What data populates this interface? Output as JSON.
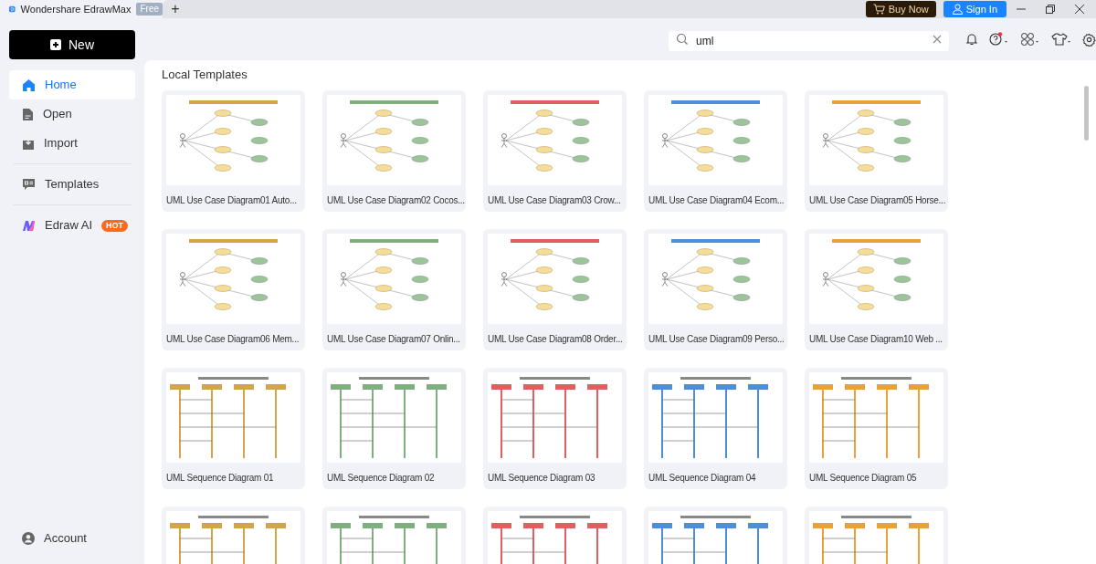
{
  "app": {
    "name": "Wondershare EdrawMax",
    "plan_badge": "Free",
    "new_tab": "+"
  },
  "header_buttons": [
    {
      "kind": "buy",
      "label": "Buy Now"
    },
    {
      "kind": "signin",
      "label": "Sign In"
    }
  ],
  "new_button": "New",
  "search": {
    "value": "uml"
  },
  "help_notification": true,
  "sidebar": {
    "items": [
      {
        "kind": "home",
        "label": "Home",
        "selected": true
      },
      {
        "kind": "open",
        "label": "Open",
        "selected": false
      },
      {
        "kind": "import",
        "label": "Import",
        "selected": false
      },
      {
        "kind": "templates",
        "label": "Templates",
        "selected": false,
        "divider_before": true
      },
      {
        "kind": "ai",
        "label": "Edraw AI",
        "badge": "HOT",
        "selected": false,
        "divider_before": true
      }
    ],
    "account": "Account"
  },
  "section_title": "Local Templates",
  "templates": [
    {
      "kind": "use_case",
      "title": "UML Use Case Diagram01 Auto..."
    },
    {
      "kind": "use_case",
      "title": "UML Use Case Diagram02 Cocos..."
    },
    {
      "kind": "use_case",
      "title": "UML Use Case Diagram03 Crow..."
    },
    {
      "kind": "use_case",
      "title": "UML Use Case Diagram04 Ecom..."
    },
    {
      "kind": "use_case",
      "title": "UML Use Case Diagram05 Horse..."
    },
    {
      "kind": "use_case",
      "title": "UML Use Case Diagram06 Mem..."
    },
    {
      "kind": "use_case",
      "title": "UML Use Case Diagram07 Onlin..."
    },
    {
      "kind": "use_case",
      "title": "UML Use Case Diagram08 Order..."
    },
    {
      "kind": "use_case",
      "title": "UML Use Case Diagram09 Perso..."
    },
    {
      "kind": "use_case",
      "title": "UML Use Case Diagram10 Web ..."
    },
    {
      "kind": "sequence",
      "title": "UML Sequence Diagram 01"
    },
    {
      "kind": "sequence",
      "title": "UML Sequence Diagram 02"
    },
    {
      "kind": "sequence",
      "title": "UML Sequence Diagram 03"
    },
    {
      "kind": "sequence",
      "title": "UML Sequence Diagram 04"
    },
    {
      "kind": "sequence",
      "title": "UML Sequence Diagram 05"
    },
    {
      "kind": "sequence"
    },
    {
      "kind": "sequence"
    },
    {
      "kind": "sequence"
    },
    {
      "kind": "sequence"
    },
    {
      "kind": "sequence"
    }
  ]
}
